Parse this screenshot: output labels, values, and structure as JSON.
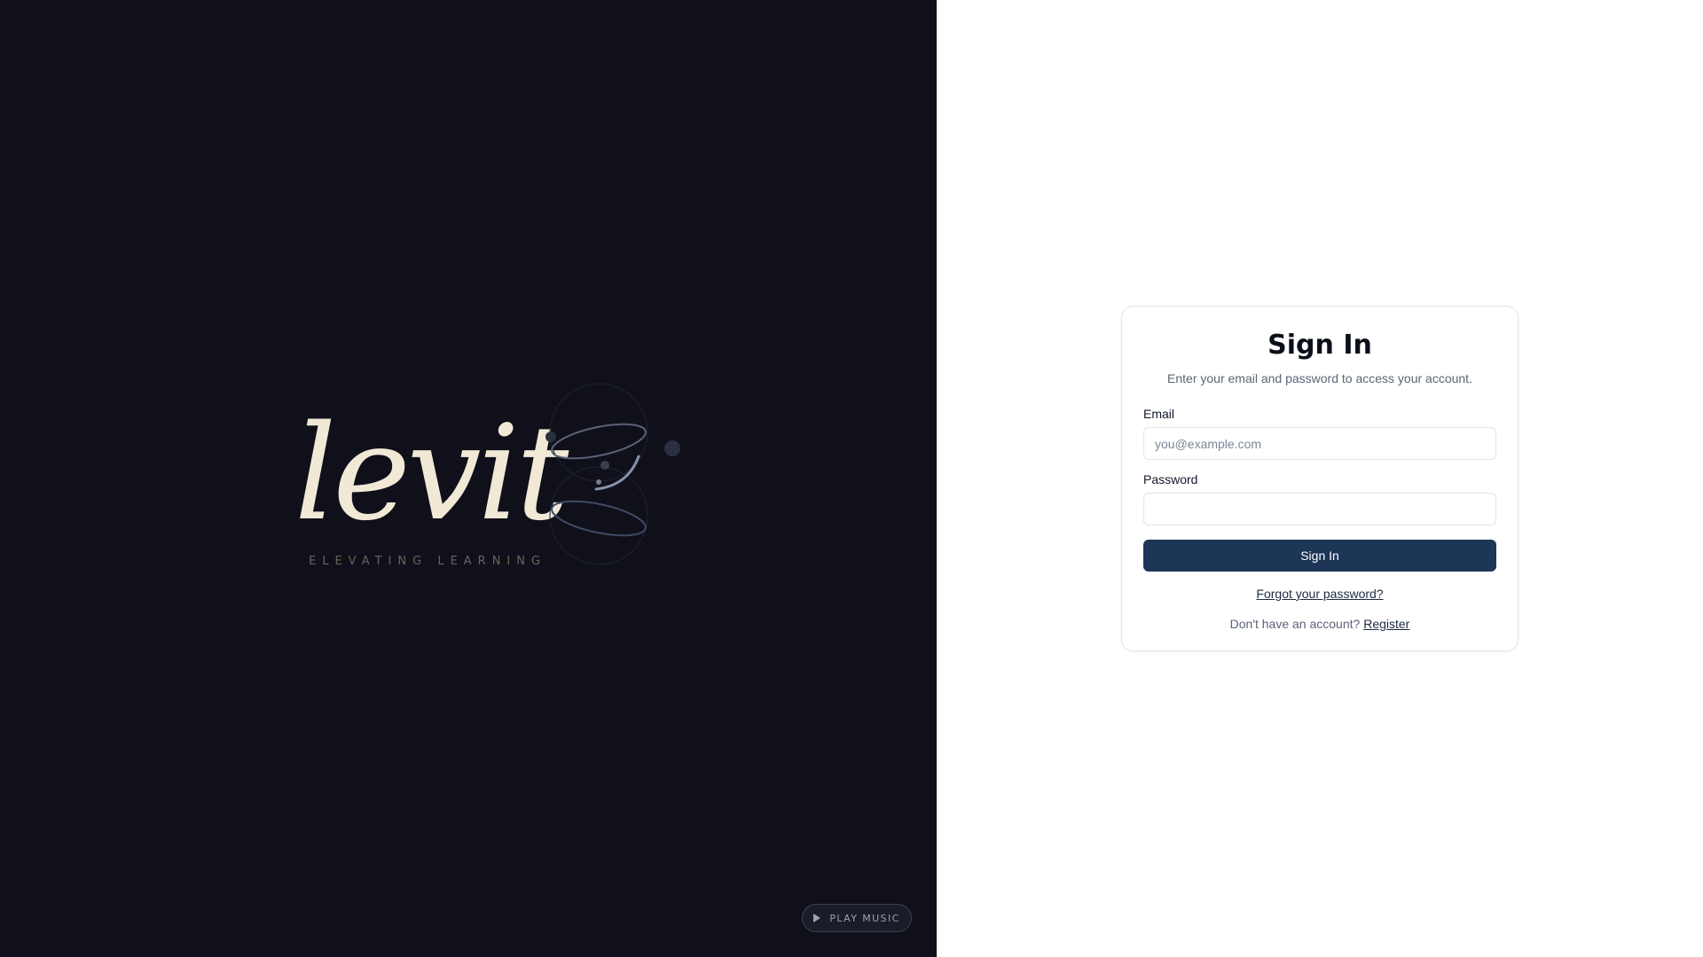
{
  "brand": {
    "wordmark": "levit",
    "tagline": "ELEVATING LEARNING"
  },
  "music": {
    "label": "PLAY MUSIC",
    "icon": "play-icon"
  },
  "signin": {
    "title": "Sign In",
    "subtitle": "Enter your email and password to access your account.",
    "email_label": "Email",
    "email_placeholder": "you@example.com",
    "email_value": "",
    "password_label": "Password",
    "password_value": "",
    "submit_label": "Sign In",
    "forgot_label": "Forgot your password?",
    "register_prompt": "Don't have an account?",
    "register_label": "Register"
  },
  "colors": {
    "left_background": "#10101a",
    "wordmark": "#f1e8d6",
    "primary_button": "#1d3557",
    "page_background": "#ffffff"
  }
}
